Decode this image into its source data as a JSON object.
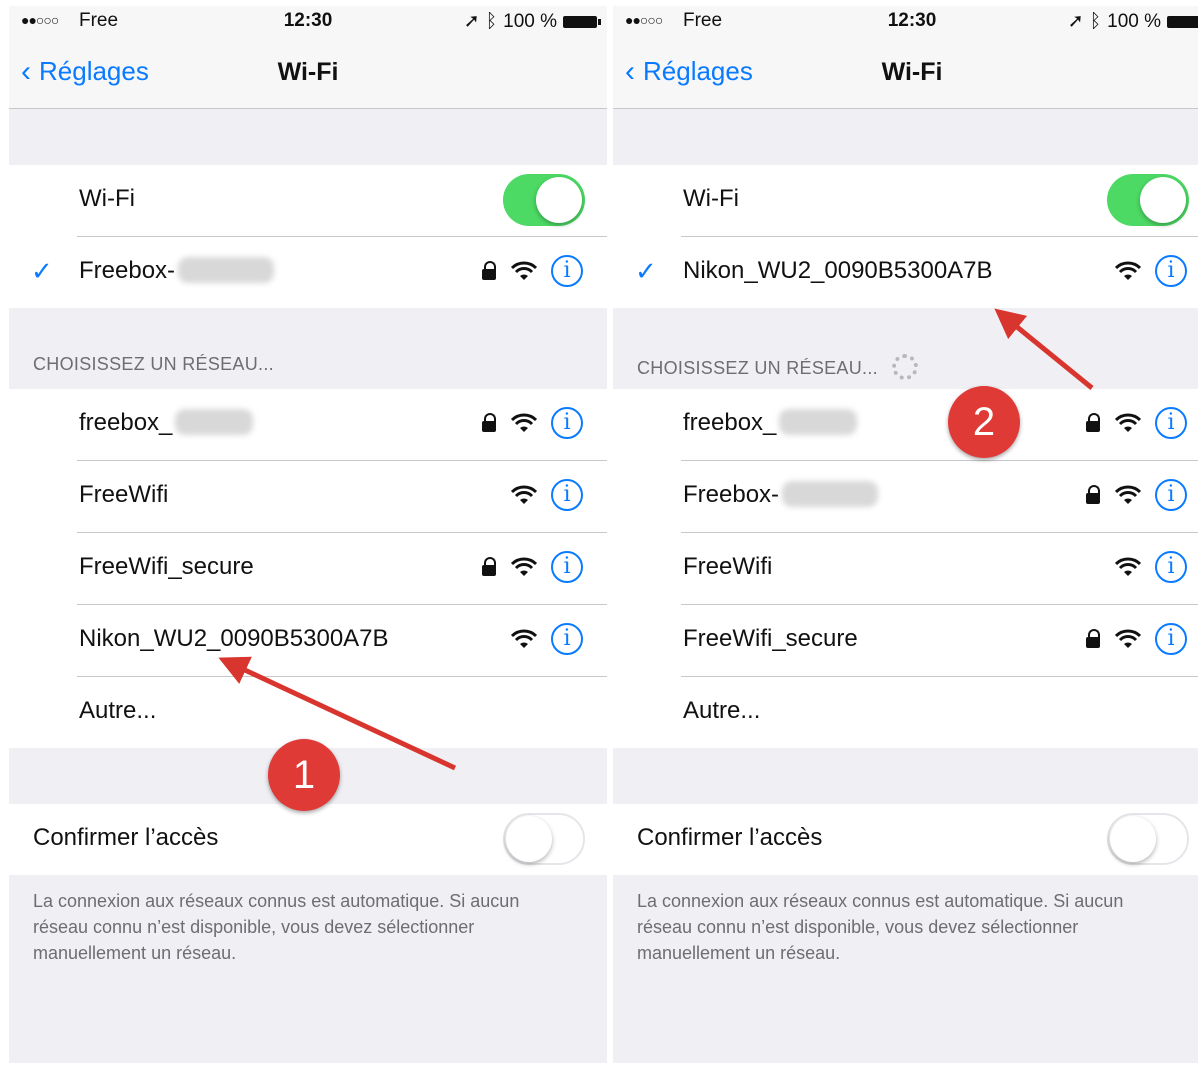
{
  "status": {
    "signal": "●●○○○",
    "carrier": "Free",
    "time": "12:30",
    "battery": "100 %"
  },
  "nav": {
    "back_label": "Réglages",
    "title": "Wi-Fi"
  },
  "wifi_label": "Wi-Fi",
  "section_header": "CHOISISSEZ UN RÉSEAU...",
  "confirm_label": "Confirmer l’accès",
  "footer": "La connexion aux réseaux connus est automatique. Si aucun réseau connu n’est disponible, vous devez sélectionner manuellement un réseau.",
  "left": {
    "connected": {
      "name": "Freebox-",
      "locked": true
    },
    "networks": [
      {
        "name": "freebox_",
        "locked": true,
        "blurred": true
      },
      {
        "name": "FreeWifi",
        "locked": false
      },
      {
        "name": "FreeWifi_secure",
        "locked": true
      },
      {
        "name": "Nikon_WU2_0090B5300A7B",
        "locked": false
      }
    ],
    "other": "Autre...",
    "badge": "1"
  },
  "right": {
    "connected": {
      "name": "Nikon_WU2_0090B5300A7B",
      "locked": false
    },
    "networks": [
      {
        "name": "freebox_",
        "locked": true,
        "blurred": true
      },
      {
        "name": "Freebox-",
        "locked": true,
        "blurred": true
      },
      {
        "name": "FreeWifi",
        "locked": false
      },
      {
        "name": "FreeWifi_secure",
        "locked": true
      }
    ],
    "other": "Autre...",
    "badge": "2"
  },
  "colors": {
    "accent": "#0a7bff",
    "toggle_on": "#4cd964",
    "badge": "#e03a37",
    "arrow": "#d9352f"
  }
}
